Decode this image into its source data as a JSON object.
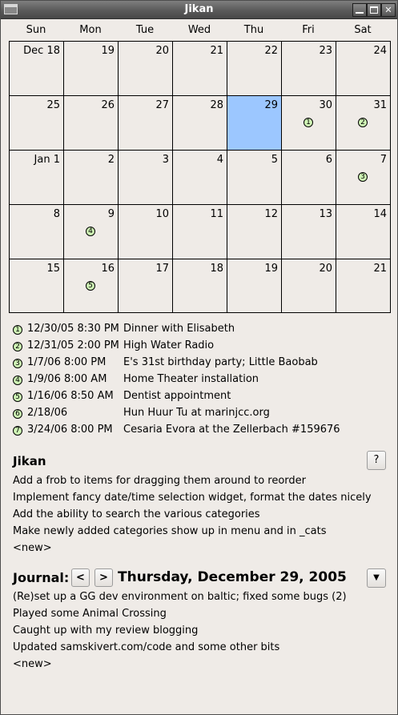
{
  "window": {
    "title": "Jikan"
  },
  "calendar": {
    "weekdays": [
      "Sun",
      "Mon",
      "Tue",
      "Wed",
      "Thu",
      "Fri",
      "Sat"
    ],
    "weeks": [
      [
        "Dec 18",
        "19",
        "20",
        "21",
        "22",
        "23",
        "24"
      ],
      [
        "25",
        "26",
        "27",
        "28",
        "29",
        "30",
        "31"
      ],
      [
        "Jan 1",
        "2",
        "3",
        "4",
        "5",
        "6",
        "7"
      ],
      [
        "8",
        "9",
        "10",
        "11",
        "12",
        "13",
        "14"
      ],
      [
        "15",
        "16",
        "17",
        "18",
        "19",
        "20",
        "21"
      ]
    ],
    "today": {
      "week": 1,
      "day": 4
    },
    "today_color": "#9cc7ff",
    "marker_color": "#cff5b5",
    "markers": [
      {
        "week": 1,
        "day": 5,
        "label": "1"
      },
      {
        "week": 1,
        "day": 6,
        "label": "2"
      },
      {
        "week": 2,
        "day": 6,
        "label": "3"
      },
      {
        "week": 3,
        "day": 1,
        "label": "4"
      },
      {
        "week": 4,
        "day": 1,
        "label": "5"
      }
    ]
  },
  "events": [
    {
      "marker": "1",
      "datetime": "12/30/05 8:30 PM",
      "description": "Dinner with Elisabeth"
    },
    {
      "marker": "2",
      "datetime": "12/31/05 2:00 PM",
      "description": "High Water Radio"
    },
    {
      "marker": "3",
      "datetime": "1/7/06 8:00 PM",
      "description": "E's 31st birthday party; Little Baobab"
    },
    {
      "marker": "4",
      "datetime": "1/9/06 8:00 AM",
      "description": "Home Theater installation"
    },
    {
      "marker": "5",
      "datetime": "1/16/06 8:50 AM",
      "description": "Dentist appointment"
    },
    {
      "marker": "6",
      "datetime": "2/18/06",
      "description": "Hun Huur Tu at marinjcc.org"
    },
    {
      "marker": "7",
      "datetime": "3/24/06 8:00 PM",
      "description": "Cesaria Evora at the Zellerbach #159676"
    }
  ],
  "todo": {
    "title": "Jikan",
    "help_label": "?",
    "items": [
      "Add a frob to items for dragging them around to reorder",
      "Implement fancy date/time selection widget, format the dates nicely",
      "Add the ability to search the various categories",
      "Make newly added categories show up in menu and in _cats",
      "<new>"
    ]
  },
  "journal": {
    "label": "Journal:",
    "prev_label": "<",
    "next_label": ">",
    "date": "Thursday, December 29, 2005",
    "dropdown_icon": "chevron-down-icon",
    "entries": [
      "(Re)set up a GG dev environment on baltic; fixed some bugs (2)",
      "Played some Animal Crossing",
      "Caught up with my review blogging",
      "Updated samskivert.com/code and some other bits",
      "<new>"
    ]
  }
}
